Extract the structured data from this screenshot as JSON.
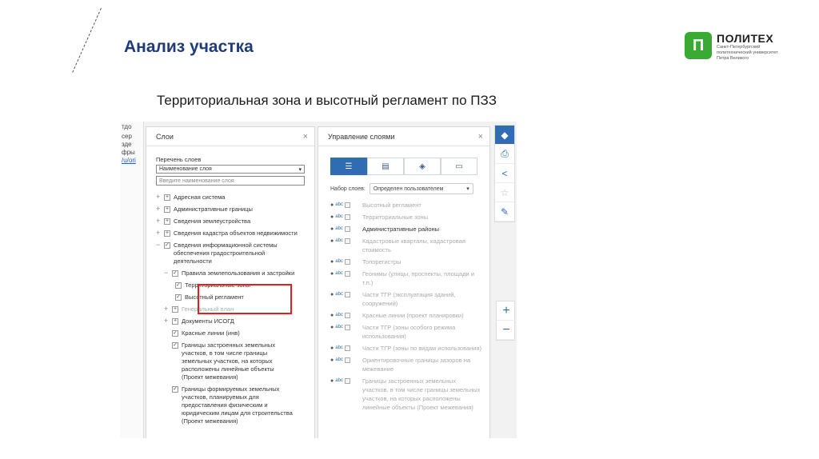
{
  "slide": {
    "title": "Анализ участка",
    "subtitle": "Территориальная зона и высотный регламент по ПЗЗ"
  },
  "logo": {
    "mark": "П",
    "name": "ПОЛИТЕХ",
    "subtitle": "Санкт-Петербургский политехнический университет Петра Великого"
  },
  "edge_strip": {
    "snippets": [
      "тдо",
      "сер",
      "зде",
      "фры",
      "/u/ori"
    ]
  },
  "layers_panel": {
    "title": "Слои",
    "close": "×",
    "list_label": "Перечень слоев",
    "select_value": "Наименование слоя",
    "search_placeholder": "Введите наименование слоя",
    "tree": [
      {
        "label": "Адресная система"
      },
      {
        "label": "Административные границы"
      },
      {
        "label": "Сведения землеустройства"
      },
      {
        "label": "Сведения кадастра объектов недвижимости"
      },
      {
        "label": "Сведения информационной системы обеспечения градостроительной деятельности"
      },
      {
        "label": "Правила землепользования и застройки"
      },
      {
        "label": "Территориальные зоны"
      },
      {
        "label": "Высотный регламент"
      },
      {
        "label": "Генеральный план"
      },
      {
        "label": "Документы ИСОГД"
      },
      {
        "label": "Красные линии (инв)"
      },
      {
        "label": "Границы застроенных земельных участков, в том числе границы земельных участков, на которых расположены линейные объекты (Проект межевания)"
      },
      {
        "label": "Границы формируемых земельных участков, планируемых для предоставления физическим и юридическим лицам для строительства (Проект межевания)"
      }
    ]
  },
  "manage_panel": {
    "title": "Управление слоями",
    "close": "×",
    "set_label": "Набор слоев:",
    "set_value": "Определен пользователем",
    "rows": [
      {
        "label": "Высотный регламент"
      },
      {
        "label": "Территориальные зоны"
      },
      {
        "label": "Административные районы"
      },
      {
        "label": "Кадастровые кварталы, кадастровая стоимость"
      },
      {
        "label": "Топорегистры"
      },
      {
        "label": "Геонимы (улицы, проспекты, площади и т.п.)"
      },
      {
        "label": "Части ТГР (эксплуатация зданий, сооружений)"
      },
      {
        "label": "Красные линии (проект планировки)"
      },
      {
        "label": "Части ТГР (зоны особого режима использования)"
      },
      {
        "label": "Части ТГР (зоны по видам использования)"
      },
      {
        "label": "Ориентировочные границы зазоров на межевание"
      },
      {
        "label": "Границы застроенных земельных участков, в том числе границы земельных участков, на которых расположены линейные объекты (Проект межевания)"
      }
    ]
  },
  "colors": {
    "accent": "#2f6cb3",
    "highlight": "#e02020",
    "logo_green": "#3aaa35",
    "title_blue": "#1f3b7a"
  }
}
